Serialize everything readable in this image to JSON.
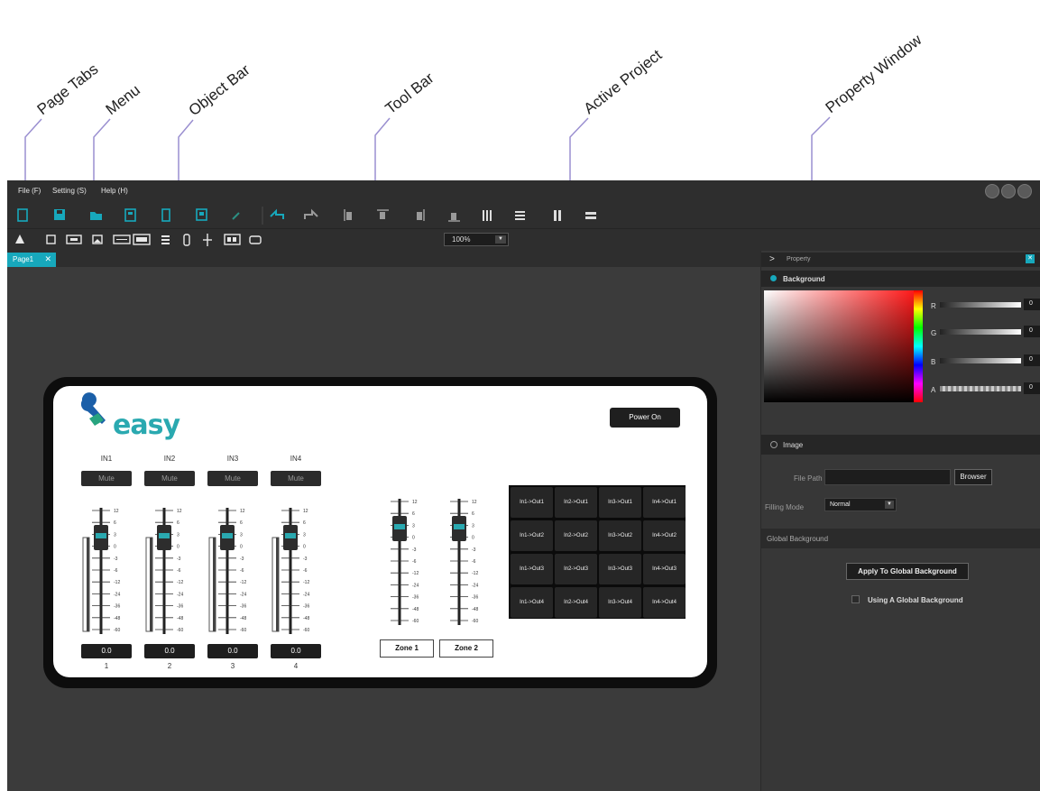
{
  "callouts": {
    "page_tabs": "Page Tabs",
    "menu": "Menu",
    "object_bar": "Object Bar",
    "tool_bar": "Tool Bar",
    "active_project": "Active Project",
    "property_window": "Property Window"
  },
  "menu": {
    "file": "File (F)",
    "setting": "Setting (S)",
    "help": "Help (H)"
  },
  "toolbar_icons": [
    "new-page-icon",
    "save-icon",
    "open-folder-icon",
    "tablet-icon",
    "phone-icon",
    "export-icon",
    "clear-icon",
    "undo-icon",
    "redo-icon",
    "align-left-icon",
    "align-top-icon",
    "align-right-icon",
    "align-bottom-icon",
    "distribute-horizontal-icon",
    "distribute-vertical-icon",
    "same-width-icon",
    "same-height-icon"
  ],
  "objectbar_icons": [
    "pointer-icon",
    "label-icon",
    "button-icon",
    "image-icon",
    "textbox-icon",
    "toggle-icon",
    "list-icon",
    "slider-icon",
    "fader-icon",
    "spinbox-icon",
    "panel-icon"
  ],
  "zoom": {
    "value": "100%"
  },
  "tabs": [
    {
      "label": "Page1"
    }
  ],
  "property": {
    "title": "Property",
    "background_section": "Background",
    "channels": [
      {
        "label": "R",
        "value": "0"
      },
      {
        "label": "G",
        "value": "0"
      },
      {
        "label": "B",
        "value": "0"
      },
      {
        "label": "A",
        "value": "0"
      }
    ],
    "image_section": "Image",
    "file_path_label": "File Path",
    "browser_button": "Browser",
    "filling_mode_label": "Filling Mode",
    "filling_mode_value": "Normal",
    "global_background_section": "Global Background",
    "apply_button": "Apply To Global Background",
    "using_global_label": "Using A Global Background"
  },
  "device": {
    "logo": "easy",
    "power_button": "Power On",
    "inputs": [
      {
        "label": "IN1",
        "mute": "Mute",
        "value": "0.0",
        "number": "1"
      },
      {
        "label": "IN2",
        "mute": "Mute",
        "value": "0.0",
        "number": "2"
      },
      {
        "label": "IN3",
        "mute": "Mute",
        "value": "0.0",
        "number": "3"
      },
      {
        "label": "IN4",
        "mute": "Mute",
        "value": "0.0",
        "number": "4"
      }
    ],
    "fader_scale": [
      "12",
      "6",
      "3",
      "0",
      "-3",
      "-6",
      "-12",
      "-24",
      "-36",
      "-48",
      "-60"
    ],
    "zones": [
      {
        "label": "Zone 1"
      },
      {
        "label": "Zone 2"
      }
    ],
    "matrix": [
      [
        "In1->Out1",
        "In2->Out1",
        "In3->Out1",
        "In4->Out1"
      ],
      [
        "In1->Out2",
        "In2->Out2",
        "In3->Out2",
        "In4->Out2"
      ],
      [
        "In1->Out3",
        "In2->Out3",
        "In3->Out3",
        "In4->Out3"
      ],
      [
        "In1->Out4",
        "In2->Out4",
        "In3->Out4",
        "In4->Out4"
      ]
    ]
  },
  "colors": {
    "accent": "#17a8bc",
    "panel_bg": "#373737",
    "canvas_bg": "#3b3b3b",
    "chrome_bg": "#2e2e2e"
  }
}
